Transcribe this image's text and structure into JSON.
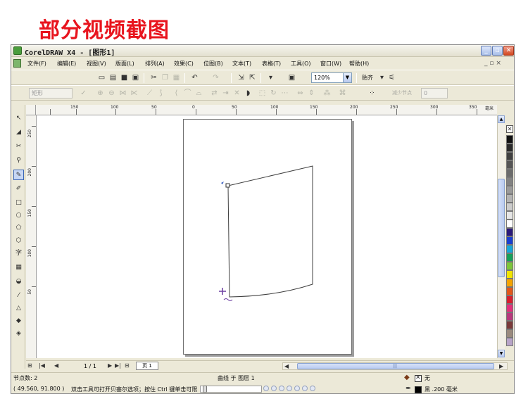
{
  "banner": {
    "title": "部分视频截图"
  },
  "window": {
    "title": "CorelDRAW X4 - [图形1]"
  },
  "menu": {
    "items": [
      "文件(F)",
      "编辑(E)",
      "视图(V)",
      "版面(L)",
      "排列(A)",
      "效果(C)",
      "位图(B)",
      "文本(T)",
      "表格(T)",
      "工具(O)",
      "窗口(W)",
      "帮助(H)"
    ],
    "mdi_controls": "_ ▫ ×"
  },
  "standard_toolbar": {
    "zoom_value": "120%",
    "snap_label": "贴齐"
  },
  "property_bar": {
    "shape_value": "矩形",
    "reduce_nodes_label": "减少节点",
    "reduce_nodes_value": "0"
  },
  "rulers": {
    "horizontal_labels": [
      "150",
      "100",
      "50",
      "0",
      "50",
      "100",
      "150",
      "200",
      "250",
      "300",
      "350"
    ],
    "horizontal_unit": "毫米",
    "vertical_labels": [
      "250",
      "200",
      "150",
      "100",
      "50"
    ]
  },
  "palette": {
    "colors": [
      "#111111",
      "#2a2a2a",
      "#404040",
      "#555555",
      "#6b6b6b",
      "#828282",
      "#9a9a9a",
      "#b3b3b3",
      "#cccccc",
      "#e6e6e6",
      "#ffffff",
      "#2b1a7a",
      "#1a3fd0",
      "#18a7d8",
      "#16a05a",
      "#7cc63a",
      "#f2e500",
      "#f5a400",
      "#e2571b",
      "#d81e2f",
      "#e3307c",
      "#b7387d",
      "#7a3a3a",
      "#9a8a7e",
      "#b8a4c8"
    ]
  },
  "page_nav": {
    "page_status": "1 / 1",
    "page_tab": "页 1"
  },
  "status": {
    "nodes": "节点数: 2",
    "object_info": "曲线 于 图层 1",
    "coords": "( 49.560, 91.800 )",
    "hint": "双击工具可打开贝塞尔选项；按住 Ctrl 键单击可限",
    "fill_label": "无",
    "outline_label": "黑 .200 毫米",
    "fill_color": "#ffffff",
    "outline_color": "#000000"
  }
}
